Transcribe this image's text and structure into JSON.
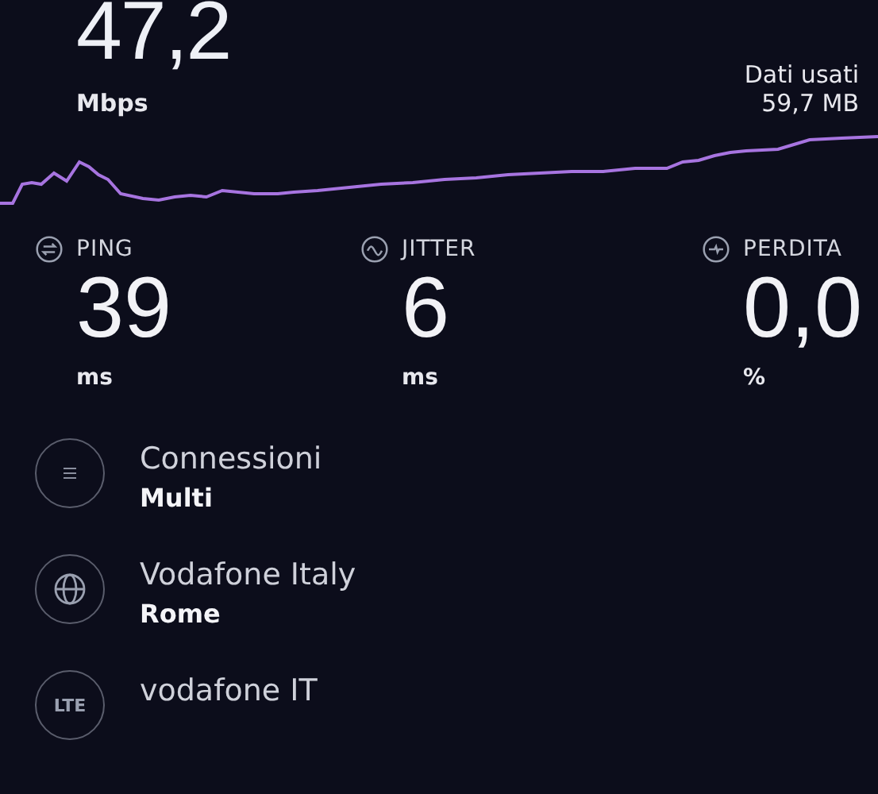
{
  "speed": {
    "value": "47,2",
    "unit": "Mbps"
  },
  "data_used": {
    "label": "Dati usati",
    "value": "59,7 MB"
  },
  "stats": [
    {
      "kind": "ping",
      "label": "PING",
      "value": "39",
      "unit": "ms"
    },
    {
      "kind": "jitter",
      "label": "JITTER",
      "value": "6",
      "unit": "ms"
    },
    {
      "kind": "loss",
      "label": "PERDITA",
      "value": "0,0",
      "unit": "%"
    }
  ],
  "details": [
    {
      "kind": "connections",
      "title": "Connessioni",
      "subtitle": "Multi"
    },
    {
      "kind": "globe",
      "title": "Vodafone Italy",
      "subtitle": "Rome"
    },
    {
      "kind": "badge",
      "badge_text": "LTE",
      "title": "vodafone IT"
    }
  ]
}
